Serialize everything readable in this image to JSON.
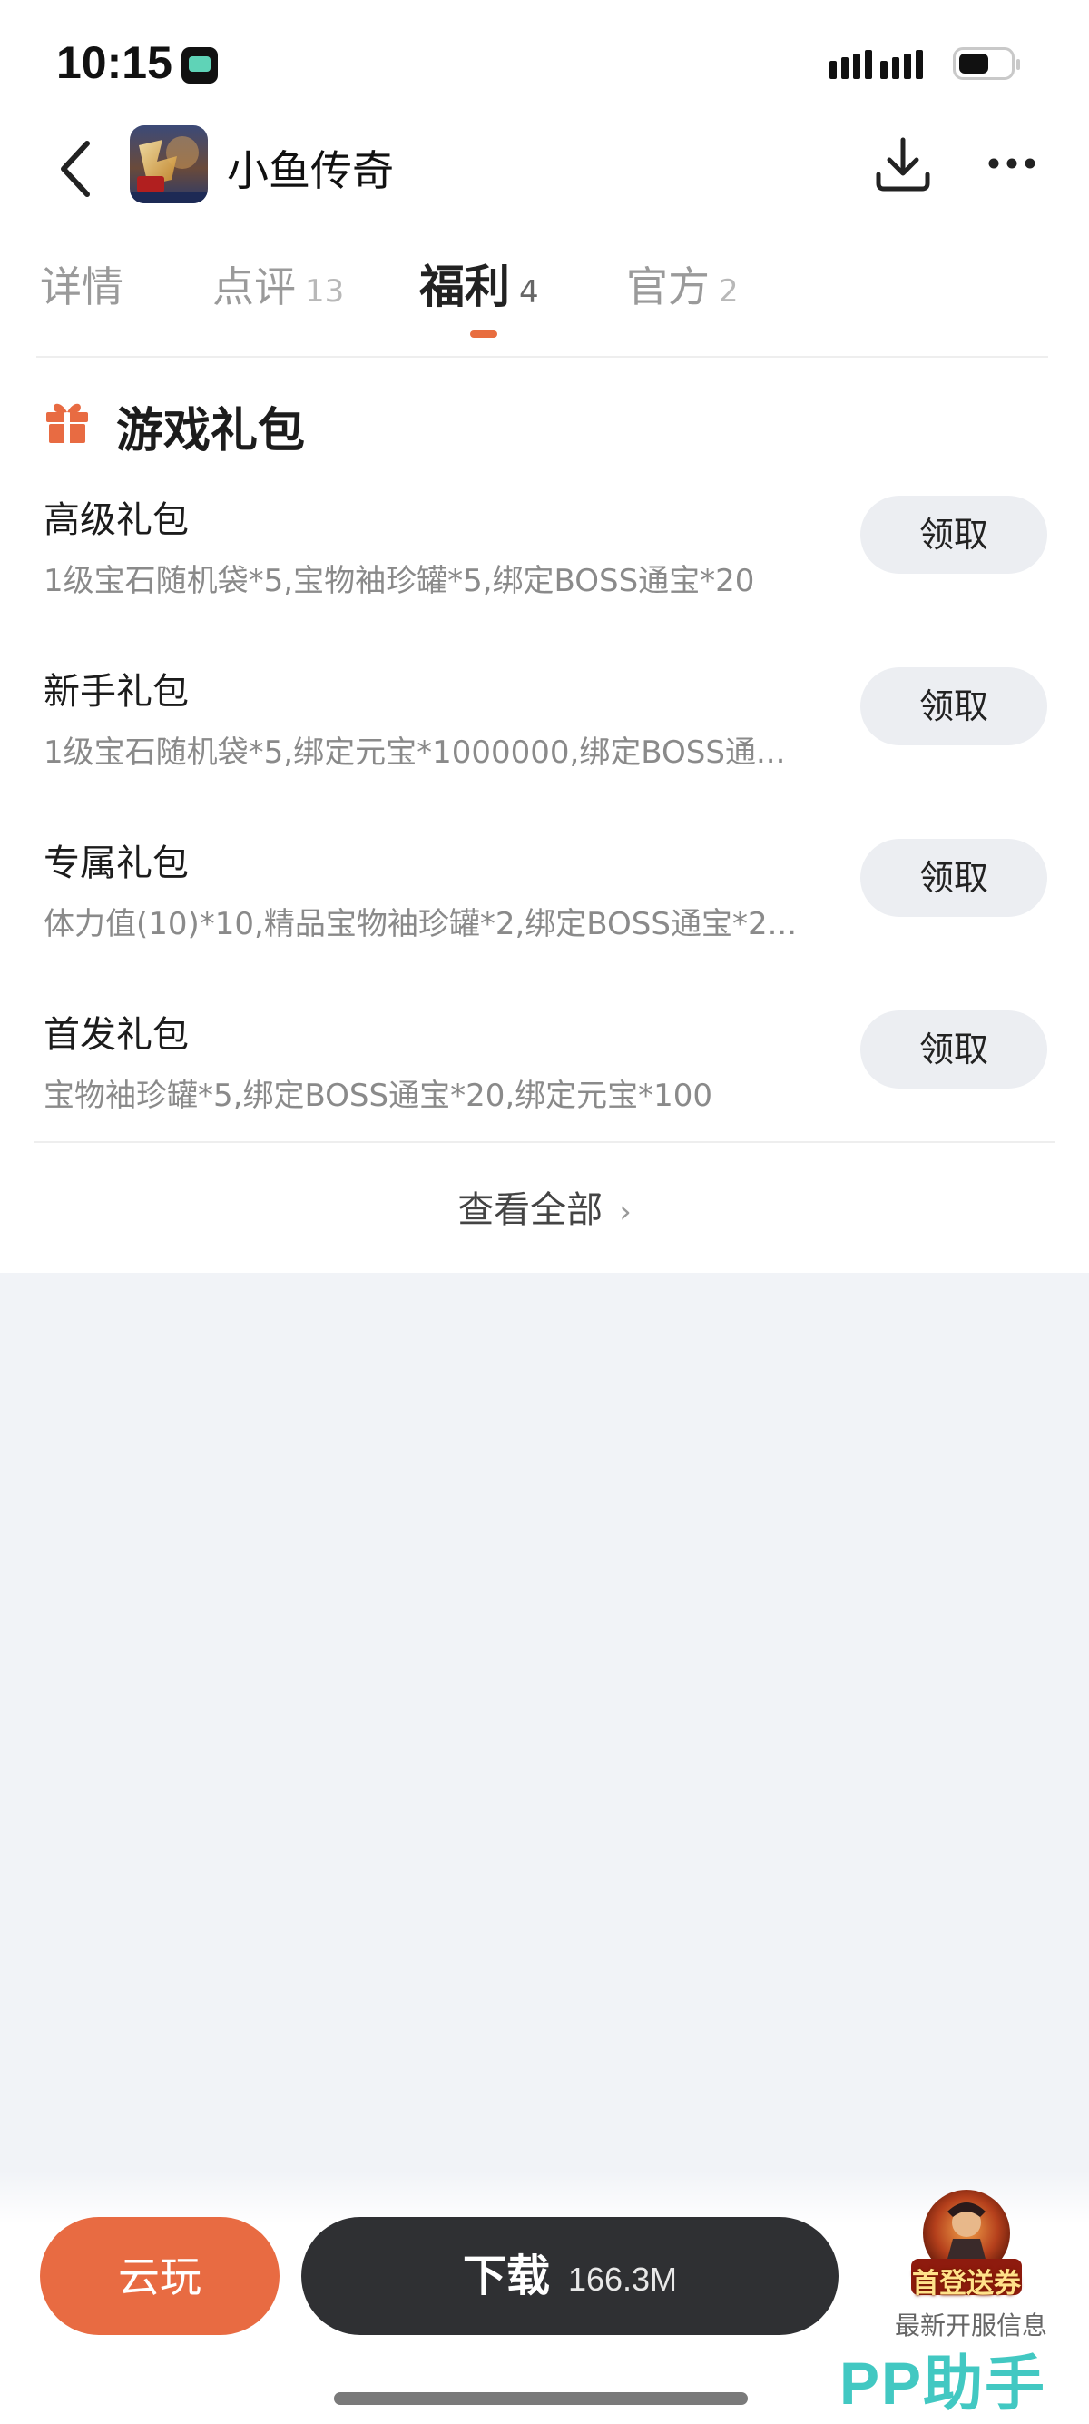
{
  "status_bar": {
    "time": "10:15"
  },
  "header": {
    "title": "小鱼传奇",
    "back_icon": "chevron-left-icon",
    "download_icon": "download-icon",
    "more_icon": "more-horizontal-icon"
  },
  "tabs": [
    {
      "label": "详情",
      "count": ""
    },
    {
      "label": "点评",
      "count": "13"
    },
    {
      "label": "福利",
      "count": "4",
      "active": true
    },
    {
      "label": "官方",
      "count": "2"
    }
  ],
  "section": {
    "title": "游戏礼包",
    "icon": "gift-icon"
  },
  "gifts": [
    {
      "name": "高级礼包",
      "desc": "1级宝石随机袋*5,宝物袖珍罐*5,绑定BOSS通宝*20",
      "action": "领取"
    },
    {
      "name": "新手礼包",
      "desc": "1级宝石随机袋*5,绑定元宝*1000000,绑定BOSS通...",
      "action": "领取"
    },
    {
      "name": "专属礼包",
      "desc": "体力值(10)*10,精品宝物袖珍罐*2,绑定BOSS通宝*2...",
      "action": "领取"
    },
    {
      "name": "首发礼包",
      "desc": "宝物袖珍罐*5,绑定BOSS通宝*20,绑定元宝*100",
      "action": "领取"
    }
  ],
  "view_all": {
    "label": "查看全部",
    "chevron": "›"
  },
  "bottom_bar": {
    "cloud_play": "云玩",
    "download_label": "下载",
    "download_size": "166.3M",
    "promo_badge": "首登送券",
    "promo_caption": "最新开服信息"
  },
  "watermark": "PP助手",
  "colors": {
    "accent": "#e86b42",
    "dark_button": "#2f3033",
    "watermark": "#42c8c2"
  }
}
